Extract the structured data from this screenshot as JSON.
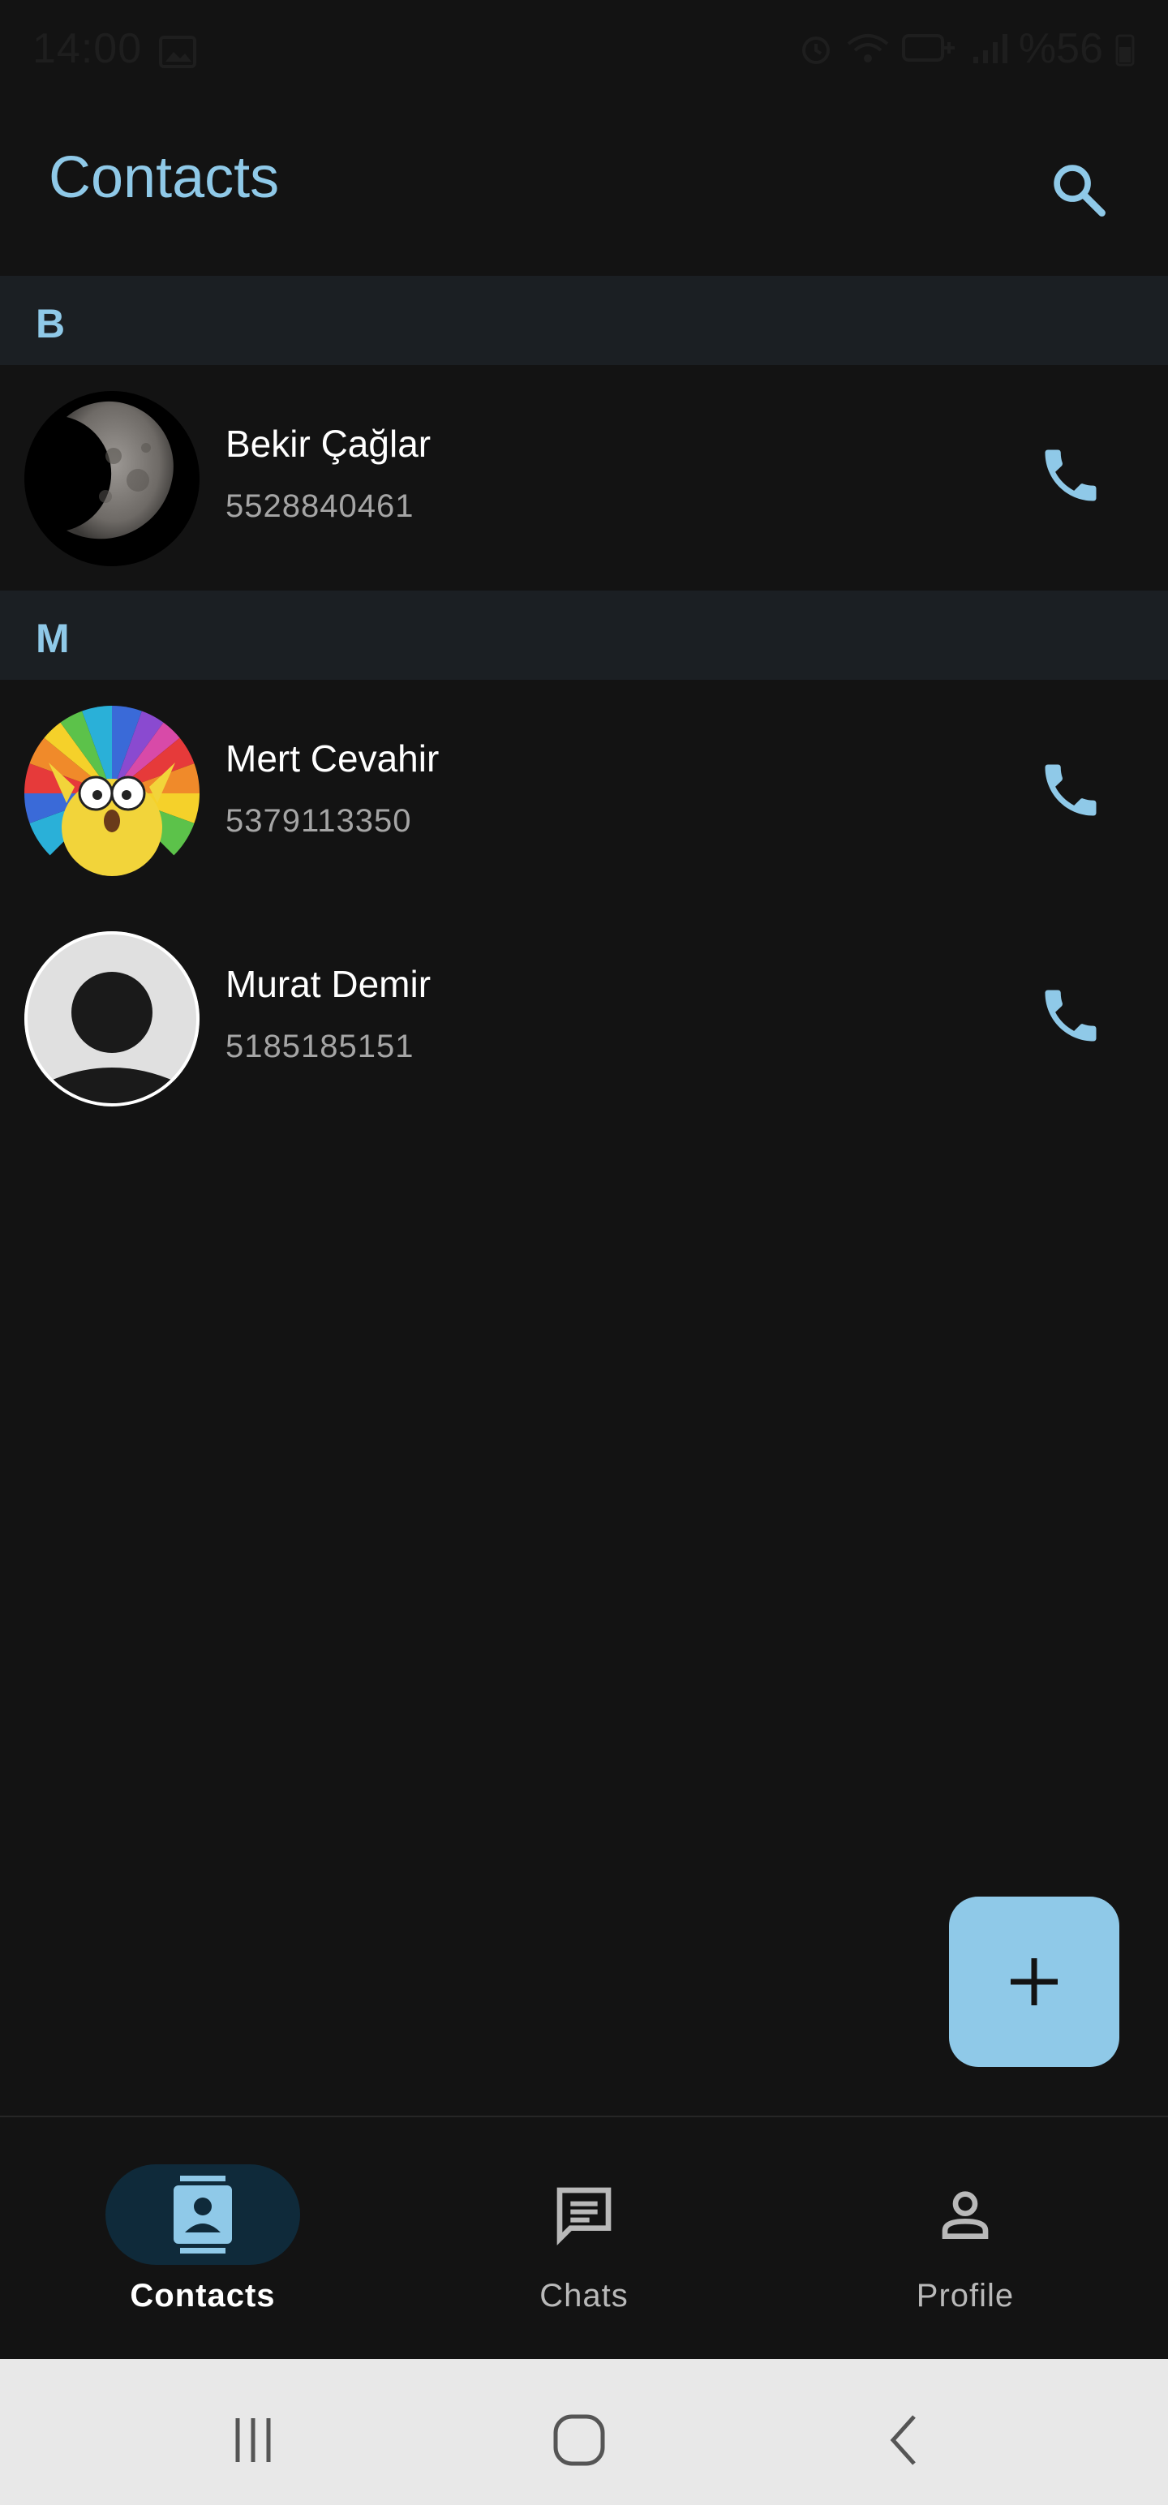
{
  "status_bar": {
    "time": "14:00",
    "battery": "%56",
    "icons": [
      "gallery-icon",
      "alarm-icon",
      "wifi-icon",
      "hd-plus-icon",
      "signal-icon",
      "battery-icon"
    ]
  },
  "app_bar": {
    "title": "Contacts",
    "search_icon": "search-icon"
  },
  "sections": [
    {
      "letter": "B",
      "contacts": [
        {
          "name": "Bekir Çağlar",
          "phone": "5528840461",
          "avatar": "moon-photo"
        }
      ]
    },
    {
      "letter": "M",
      "contacts": [
        {
          "name": "Mert Cevahir",
          "phone": "5379113350",
          "avatar": "cartoon-rainbow"
        },
        {
          "name": "Murat Demir",
          "phone": "5185185151",
          "avatar": "default-person"
        }
      ]
    }
  ],
  "fab": {
    "icon": "plus-icon"
  },
  "bottom_nav": {
    "items": [
      {
        "label": "Contacts",
        "icon": "contacts-icon",
        "active": true
      },
      {
        "label": "Chats",
        "icon": "chat-icon",
        "active": false
      },
      {
        "label": "Profile",
        "icon": "profile-icon",
        "active": false
      }
    ]
  },
  "colors": {
    "accent": "#8fc9e8",
    "background": "#131313",
    "section_header": "#1b1f23",
    "nav_active_pill": "#0f2a3a"
  }
}
